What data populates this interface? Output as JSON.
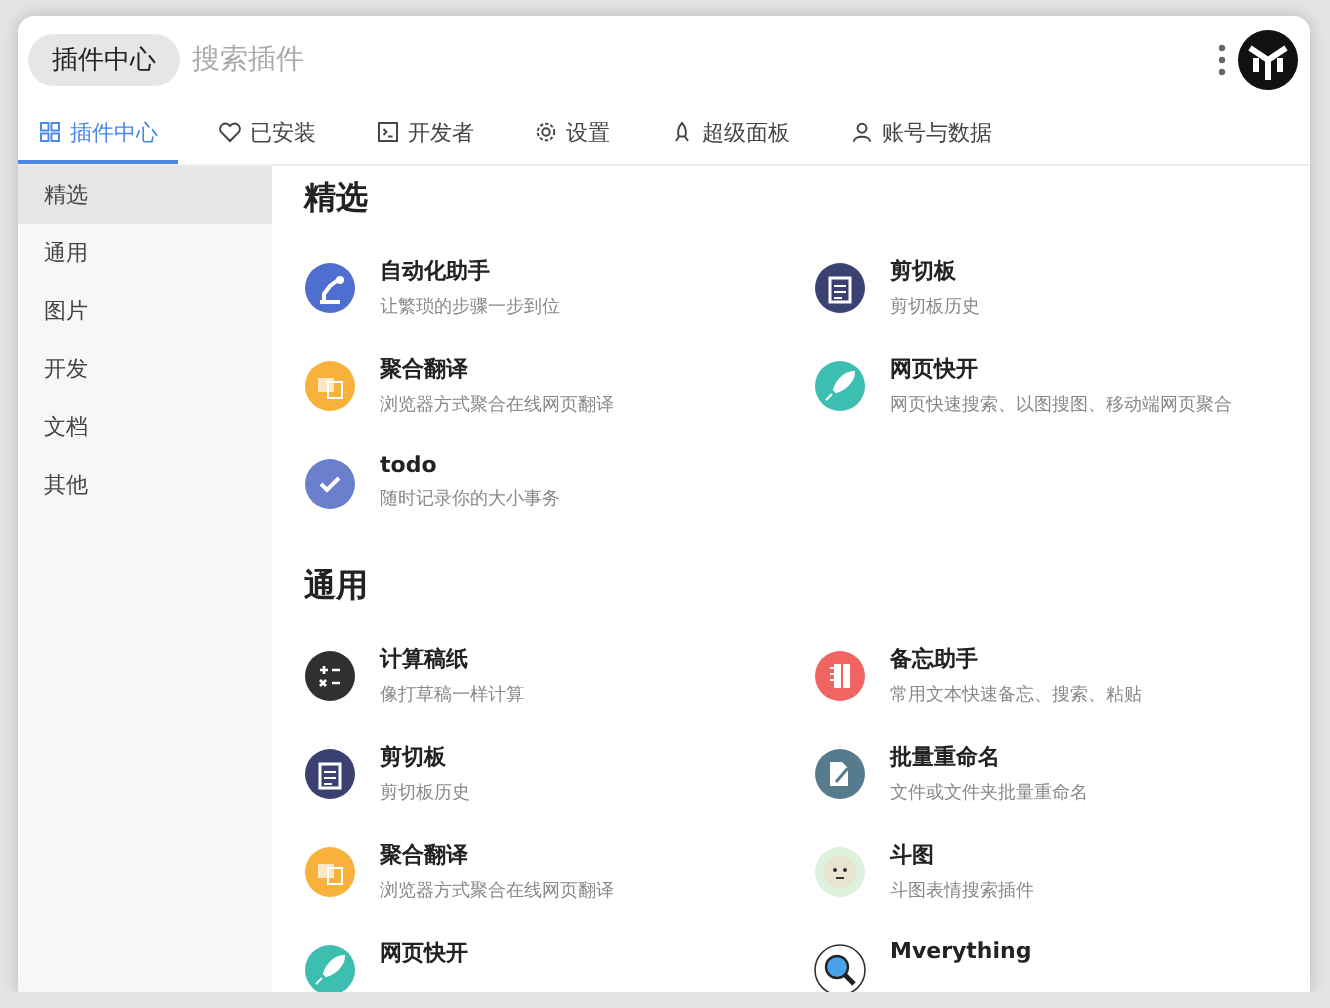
{
  "search": {
    "tag": "插件中心",
    "placeholder": "搜索插件"
  },
  "tabs": [
    {
      "label": "插件中心",
      "kind": "grid",
      "selected": true
    },
    {
      "label": "已安装",
      "kind": "heart",
      "selected": false
    },
    {
      "label": "开发者",
      "kind": "terminal",
      "selected": false
    },
    {
      "label": "设置",
      "kind": "gear",
      "selected": false
    },
    {
      "label": "超级面板",
      "kind": "rocket",
      "selected": false
    },
    {
      "label": "账号与数据",
      "kind": "person",
      "selected": false
    }
  ],
  "sidebar": {
    "items": [
      {
        "label": "精选",
        "selected": true
      },
      {
        "label": "通用",
        "selected": false
      },
      {
        "label": "图片",
        "selected": false
      },
      {
        "label": "开发",
        "selected": false
      },
      {
        "label": "文档",
        "selected": false
      },
      {
        "label": "其他",
        "selected": false
      }
    ]
  },
  "sections": [
    {
      "title": "精选",
      "plugins": [
        {
          "name": "自动化助手",
          "desc": "让繁琐的步骤一步到位",
          "kind": "robot",
          "color": "#4f6fd0"
        },
        {
          "name": "剪切板",
          "desc": "剪切板历史",
          "kind": "clipboard",
          "color": "#3b4272"
        },
        {
          "name": "聚合翻译",
          "desc": "浏览器方式聚合在线网页翻译",
          "kind": "translate",
          "color": "#f8b23c"
        },
        {
          "name": "网页快开",
          "desc": "网页快速搜索、以图搜图、移动端网页聚合",
          "kind": "rocket",
          "color": "#3cbfb0"
        },
        {
          "name": "todo",
          "desc": "随时记录你的大小事务",
          "kind": "check",
          "color": "#6b80cc"
        }
      ]
    },
    {
      "title": "通用",
      "plugins": [
        {
          "name": "计算稿纸",
          "desc": "像打草稿一样计算",
          "kind": "calc",
          "color": "#2f2f2f"
        },
        {
          "name": "备忘助手",
          "desc": "常用文本快速备忘、搜索、粘贴",
          "kind": "notebook",
          "color": "#f06462"
        },
        {
          "name": "剪切板",
          "desc": "剪切板历史",
          "kind": "clipboard",
          "color": "#3b4272"
        },
        {
          "name": "批量重命名",
          "desc": "文件或文件夹批量重命名",
          "kind": "rename",
          "color": "#557b8c"
        },
        {
          "name": "聚合翻译",
          "desc": "浏览器方式聚合在线网页翻译",
          "kind": "translate",
          "color": "#f8b23c"
        },
        {
          "name": "斗图",
          "desc": "斗图表情搜索插件",
          "kind": "face",
          "color": "#dff0dc"
        },
        {
          "name": "网页快开",
          "kind": "rocket",
          "color": "#3cbfb0"
        },
        {
          "name": "Mverything",
          "kind": "magnifier",
          "color": "#4aa3ea"
        }
      ]
    }
  ]
}
